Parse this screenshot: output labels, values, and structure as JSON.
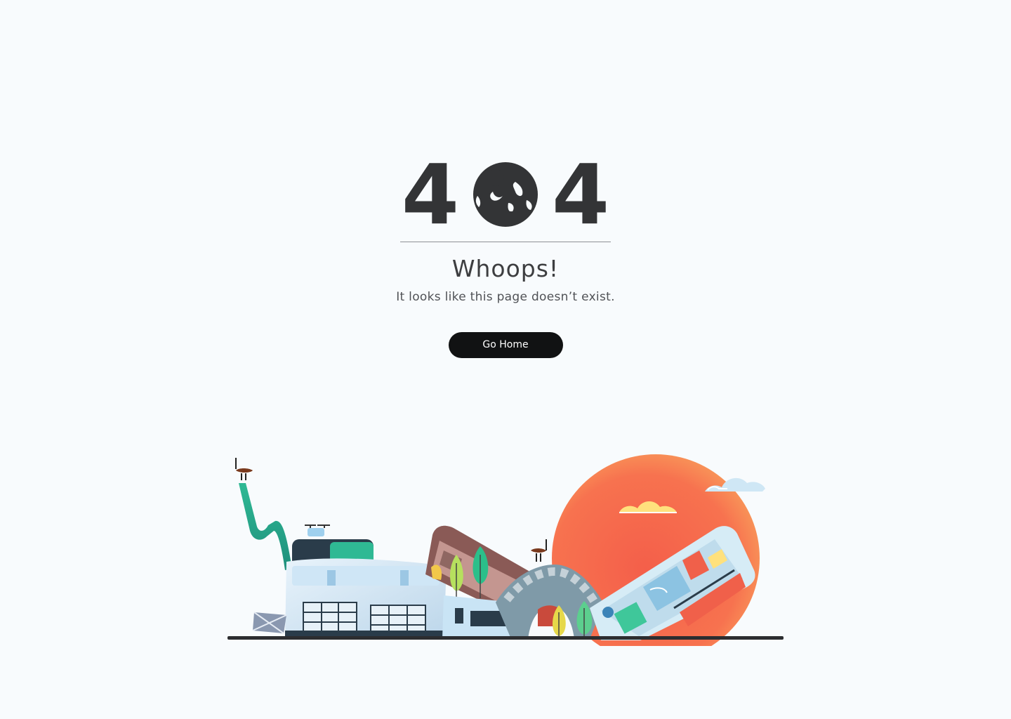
{
  "error": {
    "digit_left": "4",
    "digit_right": "4",
    "globe_icon": "globe-icon",
    "title": "Whoops!",
    "message": "It looks like this page doesn’t exist."
  },
  "actions": {
    "home_label": "Go Home"
  },
  "colors": {
    "background": "#f8fbfd",
    "text_dark": "#333436",
    "button_bg": "#111213",
    "sun": "#f86a4e",
    "teal": "#2bb58f",
    "ground": "#2c2d30"
  }
}
